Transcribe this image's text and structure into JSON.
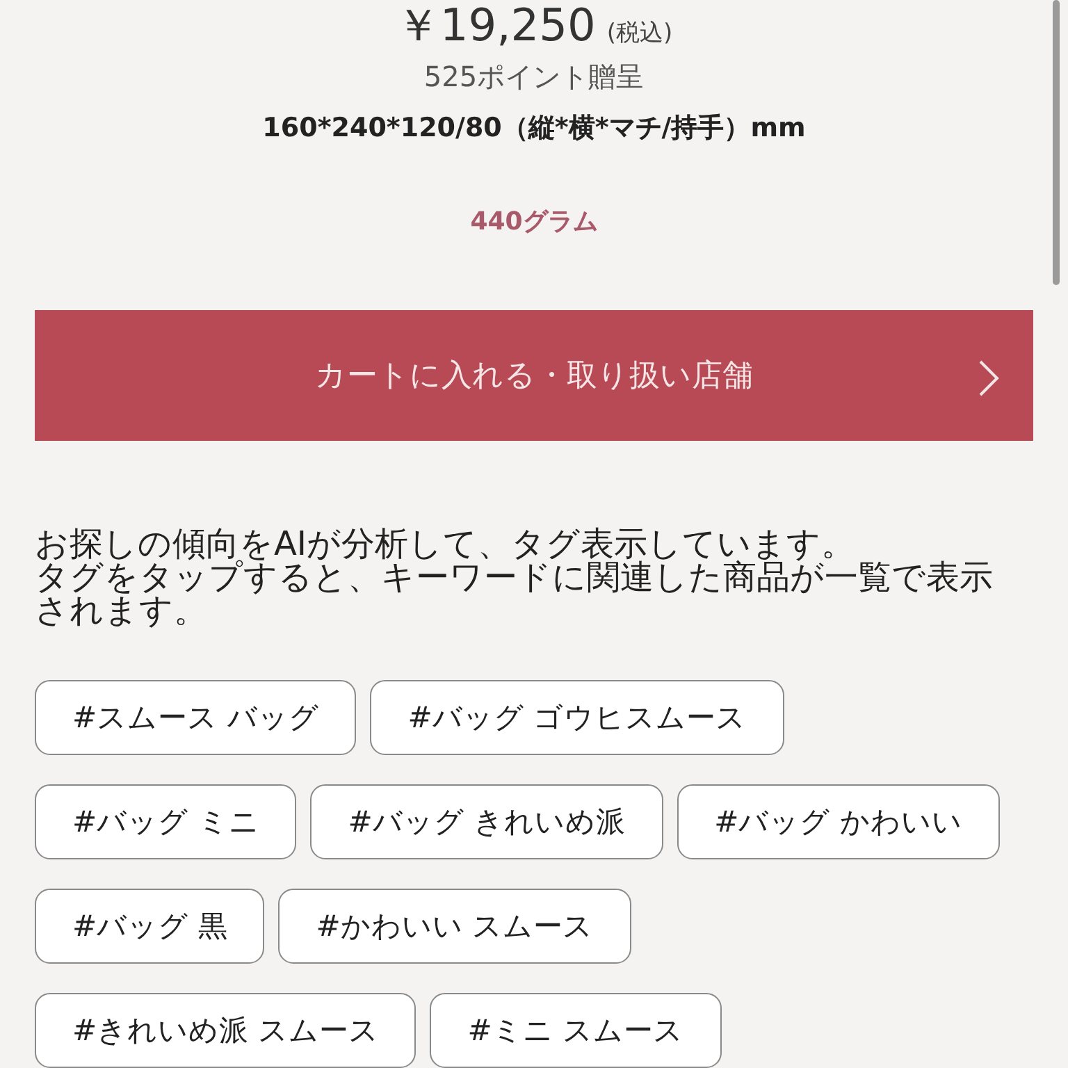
{
  "price": {
    "amount": "￥19,250",
    "tax_note": "(税込)"
  },
  "points": "525ポイント贈呈",
  "dimensions": "160*240*120/80（縦*横*マチ/持手）mm",
  "weight": "440グラム",
  "cart_button": {
    "label": "カートに入れる・取り扱い店舗"
  },
  "ai_note": [
    "お探しの傾向をAIが分析して、タグ表示しています。",
    "タグをタップすると、キーワードに関連した商品が一覧で表示されます。"
  ],
  "tags": [
    [
      "#スムース バッグ",
      "#バッグ ゴウヒスムース"
    ],
    [
      "#バッグ ミニ",
      "#バッグ きれいめ派",
      "#バッグ かわいい"
    ],
    [
      "#バッグ 黒",
      "#かわいい スムース"
    ],
    [
      "#きれいめ派 スムース",
      "#ミニ スムース"
    ]
  ]
}
